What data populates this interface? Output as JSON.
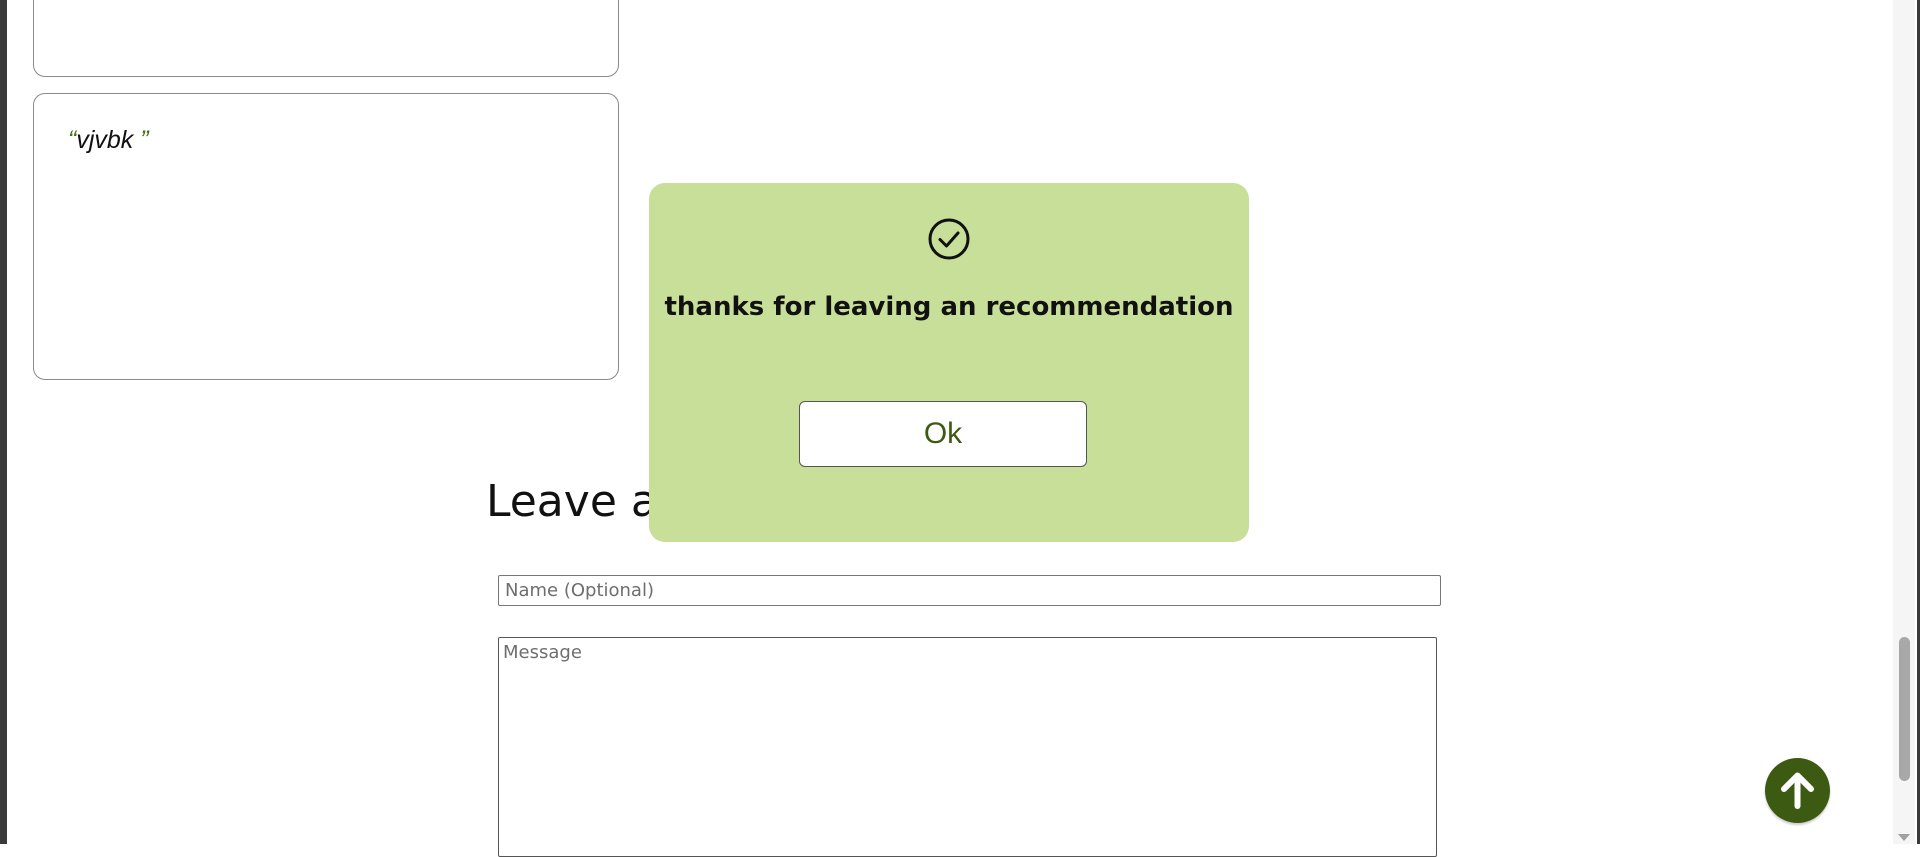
{
  "recommendations": [
    {
      "text": ""
    },
    {
      "text": "vjvbk ",
      "open_quote": "“",
      "close_quote": "”"
    }
  ],
  "form": {
    "title": "Leave a",
    "name_placeholder": "Name (Optional)",
    "message_placeholder": "Message"
  },
  "modal": {
    "message": "thanks for leaving an recommendation",
    "ok_label": "Ok",
    "icon": "check-circle-icon"
  },
  "scroll_top": {
    "icon": "arrow-up-icon"
  },
  "colors": {
    "accent": "#3d5a12",
    "modal_bg": "#c7df98"
  }
}
